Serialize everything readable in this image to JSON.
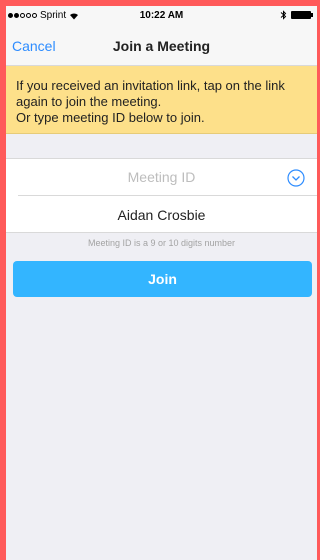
{
  "status_bar": {
    "carrier": "Sprint",
    "time": "10:22 AM"
  },
  "nav": {
    "cancel_label": "Cancel",
    "title": "Join a Meeting"
  },
  "banner": {
    "line1": "If you received an invitation link, tap on the link",
    "line2": "again to join the meeting.",
    "line3": "Or type meeting ID below to join."
  },
  "form": {
    "meeting_id_placeholder": "Meeting ID",
    "meeting_id_value": "",
    "name_value": "Aidan Crosbie",
    "hint": "Meeting ID is a 9 or 10 digits number",
    "join_label": "Join"
  },
  "colors": {
    "accent": "#2d8cff",
    "join_button": "#33b5ff",
    "banner": "#fde08a",
    "frame": "#ff5a5a"
  },
  "icons": {
    "dropdown": "chevron-down-circle-icon",
    "bluetooth": "bluetooth-icon",
    "battery": "battery-icon",
    "wifi": "wifi-icon"
  }
}
